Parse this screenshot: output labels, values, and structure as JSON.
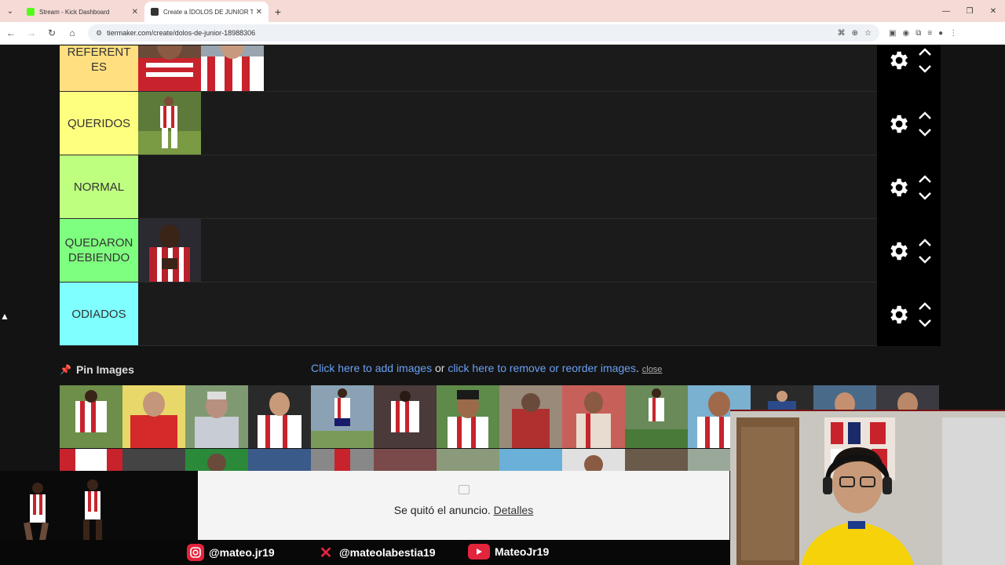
{
  "browser": {
    "tabs": [
      {
        "title": "Stream - Kick Dashboard",
        "active": false
      },
      {
        "title": "Create a ÍDOLOS DE JUNIOR Ti",
        "active": true
      }
    ],
    "url": "tiermaker.com/create/dolos-de-junior-18988306"
  },
  "tiers": [
    {
      "label": "REFERENT ES",
      "color": "#ffdf80",
      "items": 2
    },
    {
      "label": "QUERIDOS",
      "color": "#ffff7f",
      "items": 1
    },
    {
      "label": "NORMAL",
      "color": "#bfff7f",
      "items": 0
    },
    {
      "label": "QUEDARON DEBIENDO",
      "color": "#7fff7f",
      "items": 1
    },
    {
      "label": "ODIADOS",
      "color": "#7fffff",
      "items": 0
    }
  ],
  "pin": {
    "title": "Pin Images",
    "add_link": "Click here to add images",
    "or_text": " or ",
    "remove_link": "click here to remove or reorder images",
    "dot": ". ",
    "close": "close"
  },
  "ad": {
    "text": "Se quitó el anuncio. ",
    "details": "Detalles"
  },
  "social": {
    "instagram": "@mateo.jr19",
    "x": "@mateolabestia19",
    "youtube": "MateoJr19"
  },
  "colors": {
    "accent_red": "#e2243c",
    "link_blue": "#6aa0f2"
  }
}
